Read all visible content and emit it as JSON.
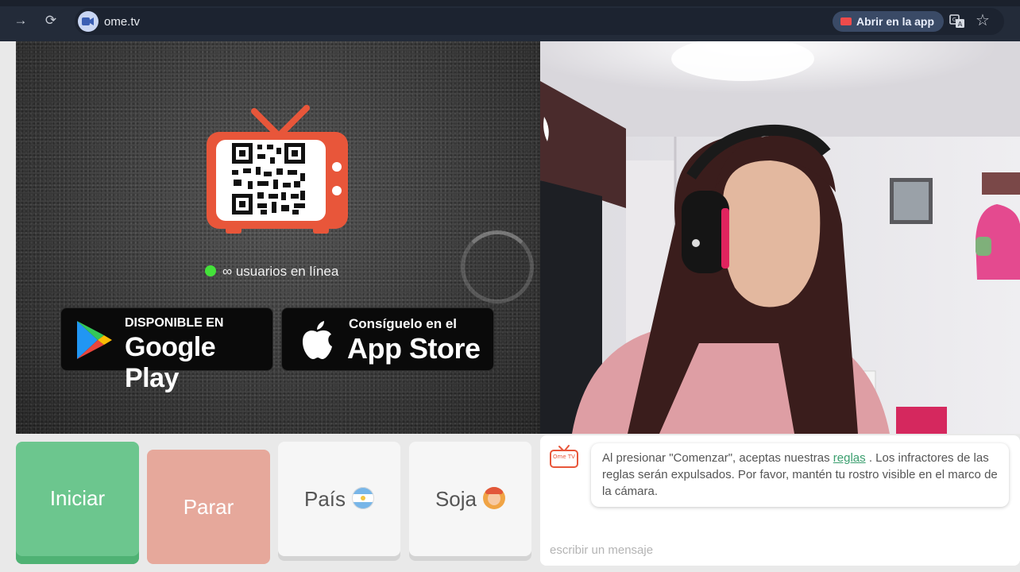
{
  "browser": {
    "url": "ome.tv",
    "open_app_label": "Abrir en la app"
  },
  "left_panel": {
    "online_text": "∞ usuarios en línea",
    "google_play": {
      "small": "DISPONIBLE EN",
      "big": "Google Play"
    },
    "app_store": {
      "small": "Consíguelo en el",
      "big": "App Store"
    }
  },
  "controls": {
    "start_label": "Iniciar",
    "stop_label": "Parar",
    "country_label": "País",
    "gender_label": "Soja"
  },
  "chat": {
    "logo_text": "Ome TV",
    "message_before": "Al presionar \"Comenzar\", aceptas nuestras ",
    "rules_link": "reglas",
    "message_after": " . Los infractores de las reglas serán expulsados. Por favor, mantén tu rostro visible en el marco de la cámara.",
    "input_placeholder": "escribir un mensaje"
  },
  "colors": {
    "start": "#6cc68e",
    "stop": "#e6a89b",
    "brand_orange": "#e8563a",
    "online_dot": "#44e23a"
  }
}
